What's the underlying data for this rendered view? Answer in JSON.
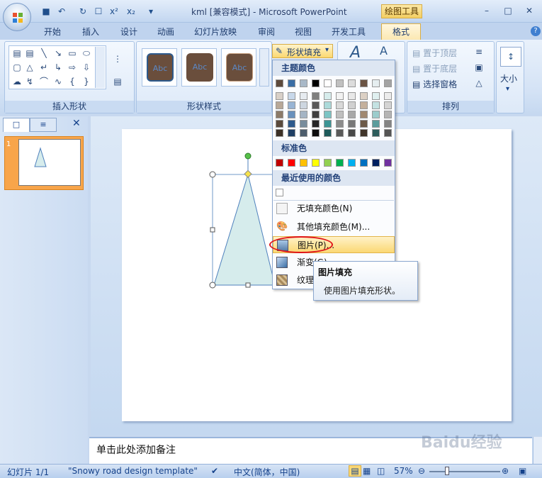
{
  "window": {
    "title": "kml [兼容模式] - Microsoft PowerPoint",
    "context_tab_label": "绘图工具",
    "min_icon": "minimize-icon",
    "max_icon": "maximize-icon",
    "close_icon": "close-icon"
  },
  "qat": [
    "save-icon",
    "undo-icon",
    "redo-icon",
    "print-preview-icon",
    "superscript-icon",
    "subscript-icon",
    "customize-icon"
  ],
  "tabs": [
    {
      "label": "开始"
    },
    {
      "label": "插入"
    },
    {
      "label": "设计"
    },
    {
      "label": "动画"
    },
    {
      "label": "幻灯片放映"
    },
    {
      "label": "审阅"
    },
    {
      "label": "视图"
    },
    {
      "label": "开发工具"
    },
    {
      "label": "格式"
    }
  ],
  "ribbon": {
    "insert_shapes_label": "插入形状",
    "shape_styles_label": "形状样式",
    "arrange_label": "排列",
    "size_label": "大小",
    "style_thumb_text": "Abc",
    "shape_fill_button": "形状填充",
    "bring_to_front": "置于顶层",
    "send_to_back": "置于底层",
    "selection_pane": "选择窗格"
  },
  "menu": {
    "theme_colors_header": "主题颜色",
    "standard_colors_header": "标准色",
    "recent_colors_header": "最近使用的颜色",
    "no_fill": "无填充颜色(N)",
    "more_fill_colors": "其他填充颜色(M)...",
    "picture": "图片(P)...",
    "gradient": "渐变(G)",
    "texture": "纹理(T)",
    "theme_top_row": [
      "#5d4a3c",
      "#3a6ea5",
      "#a8b8c8",
      "#000000",
      "#ffffff",
      "#c0c0c0",
      "#dcdcdc",
      "#6b5444",
      "#e6eef0",
      "#a3a3a3"
    ],
    "theme_cols": [
      [
        "#d8d0c8",
        "#b8a898",
        "#8c7a68",
        "#5a4a3c",
        "#3c3026"
      ],
      [
        "#c8d8ea",
        "#98b4d4",
        "#6890bc",
        "#2e5a8c",
        "#1e3e64"
      ],
      [
        "#e6ebf0",
        "#cdd6e0",
        "#a4b4c4",
        "#788c9c",
        "#4c5c6c"
      ],
      [
        "#7f7f7f",
        "#595959",
        "#3f3f3f",
        "#262626",
        "#0d0d0d"
      ],
      [
        "#d6ecec",
        "#acdada",
        "#7cc4c4",
        "#3c9494",
        "#1c5a5a"
      ],
      [
        "#f2f2f2",
        "#d9d9d9",
        "#bfbfbf",
        "#8c8c8c",
        "#595959"
      ],
      [
        "#e8e8e8",
        "#d0d0d0",
        "#a8a8a8",
        "#787878",
        "#484848"
      ],
      [
        "#dcd0c4",
        "#c4b09c",
        "#a08870",
        "#6c5a48",
        "#40342a"
      ],
      [
        "#e0f0f0",
        "#c4e2e2",
        "#9ccccc",
        "#5c9c9c",
        "#2c5c5c"
      ],
      [
        "#ececec",
        "#d4d4d4",
        "#b4b4b4",
        "#848484",
        "#545454"
      ]
    ],
    "standard_colors": [
      "#c00000",
      "#ff0000",
      "#ffc000",
      "#ffff00",
      "#92d050",
      "#00b050",
      "#00b0f0",
      "#0070c0",
      "#002060",
      "#7030a0"
    ],
    "recent_colors": [
      "#ffffff"
    ]
  },
  "tooltip": {
    "title": "图片填充",
    "body": "使用图片填充形状。"
  },
  "notes": {
    "placeholder": "单击此处添加备注"
  },
  "status": {
    "slide": "幻灯片 1/1",
    "template": "\"Snowy road design template\"",
    "language": "中文(简体，中国)",
    "zoom": "57%"
  },
  "slide_shape": {
    "fill": "#d6ecec",
    "stroke": "#4f81bd"
  },
  "watermark": "Baidu经验"
}
